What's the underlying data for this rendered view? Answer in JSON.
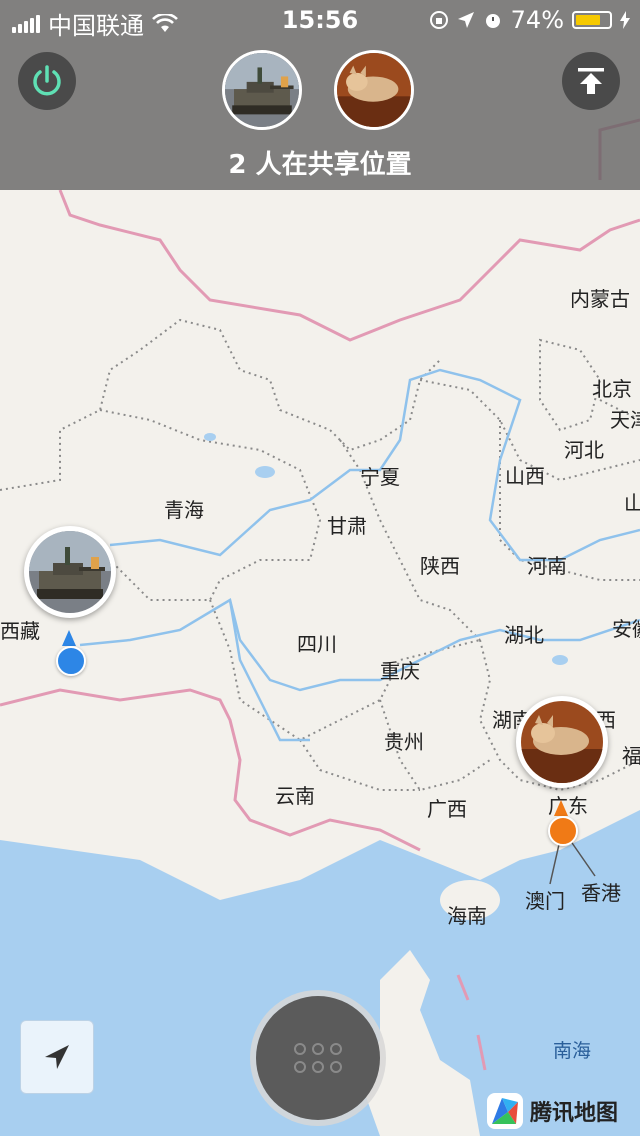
{
  "status_bar": {
    "carrier": "中国联通",
    "time": "15:56",
    "battery": "74%",
    "battery_level": 0.74
  },
  "header": {
    "share_text": "2 人在共享位置"
  },
  "icons": {
    "power": "power-icon",
    "upload": "upload-top-icon",
    "locate": "navigation-arrow-icon",
    "menu": "grid-menu-icon",
    "brand": "tencent-map-logo"
  },
  "colors": {
    "user1_dot": "#2d86e6",
    "user2_dot": "#f07a16",
    "power": "#5fe0b4",
    "sea": "#a8cff0",
    "border": "#e29ab4",
    "river": "#8fc2ec"
  },
  "map": {
    "labels": [
      "内蒙古",
      "北京",
      "天津",
      "河北",
      "山西",
      "宁夏",
      "青海",
      "甘肃",
      "陕西",
      "河南",
      "西藏",
      "四川",
      "湖北",
      "安徽",
      "重庆",
      "湖南",
      "江西",
      "福建",
      "贵州",
      "云南",
      "广西",
      "广东",
      "澳门",
      "香港",
      "海南",
      "南海",
      "山东"
    ],
    "label_text": {
      "neimenggu": "内蒙古",
      "beijing": "北京",
      "tianjin": "天津",
      "hebei": "河北",
      "shanxi": "山西",
      "ningxia": "宁夏",
      "qinghai": "青海",
      "gansu": "甘肃",
      "shaanxi": "陕西",
      "henan": "河南",
      "xizang": "西藏",
      "sichuan": "四川",
      "hubei": "湖北",
      "anhui": "安徽",
      "chongqing": "重庆",
      "hunan": "湖南",
      "jiangxi": "西",
      "fujian": "福",
      "guizhou": "贵州",
      "yunnan": "云南",
      "guangxi": "广西",
      "guangdong": "广东",
      "macau": "澳门",
      "hongkong": "香港",
      "hainan": "海南",
      "nanhai": "南海",
      "shandong": "山"
    }
  },
  "brand": {
    "name": "腾讯地图"
  }
}
